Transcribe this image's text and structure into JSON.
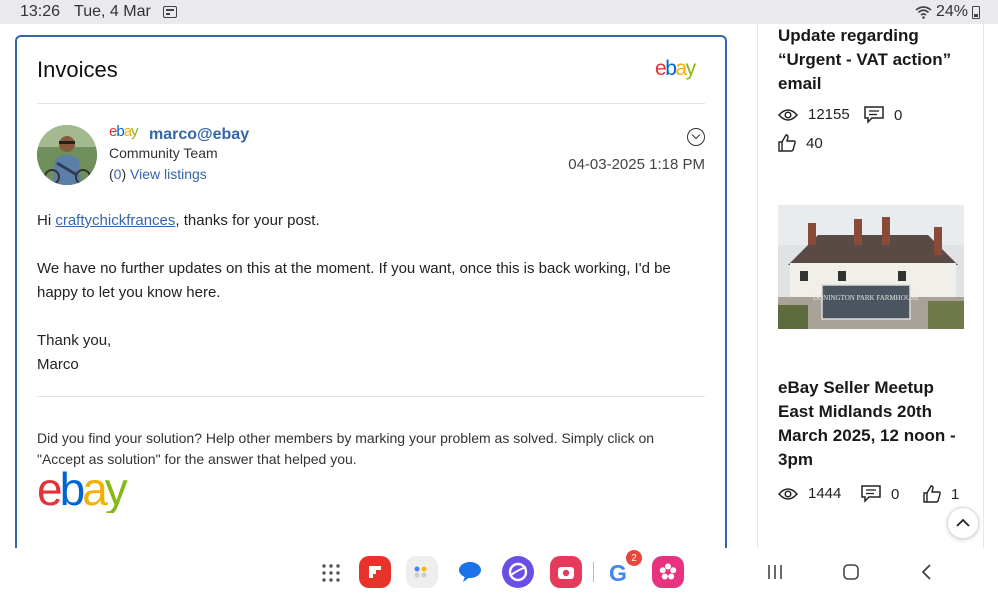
{
  "status_bar": {
    "time": "13:26",
    "date": "Tue, 4 Mar",
    "battery": "24%"
  },
  "post": {
    "board_title": "Invoices",
    "brand_logo": "ebay",
    "author": {
      "logo_text": "ebay",
      "name": "marco@ebay",
      "rank": "Community Team",
      "listings_open": "(",
      "listings_count": "0",
      "listings_close": ")",
      "listings_link": "View listings"
    },
    "timestamp": "04-03-2025 1:18 PM",
    "body": {
      "greeting_prefix": "Hi ",
      "mention": "craftychickfrances",
      "greeting_suffix": ", thanks for your post.",
      "paragraph": "We have no further updates on this at the moment. If you want, once this is back working, I'd be happy to let you know here.",
      "sign_off": "Thank you,",
      "signature_name": "Marco"
    },
    "signature_text": "Did you find your solution? Help other members by marking your problem as solved. Simply click on \"Accept as solution\" for the answer that helped you.",
    "signature_logo": "ebay"
  },
  "sidebar": {
    "article1": {
      "title": "Update regarding “Urgent - VAT action” email",
      "views": "12155",
      "comments": "0",
      "likes": "40"
    },
    "article2": {
      "image_caption": "DONINGTON PARK FARMHOUSE",
      "title": "eBay Seller Meetup East Midlands 20th March 2025, 12 noon - 3pm",
      "views": "1444",
      "comments": "0",
      "likes": "1"
    }
  },
  "navbar": {
    "google_badge": "2"
  }
}
